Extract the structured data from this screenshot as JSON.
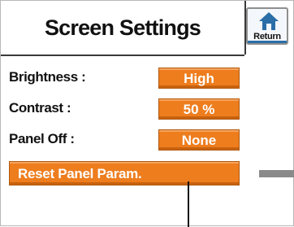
{
  "header": {
    "title": "Screen Settings",
    "return_label": "Return"
  },
  "settings": {
    "brightness": {
      "label": "Brightness :",
      "value": "High"
    },
    "contrast": {
      "label": "Contrast :",
      "value": "50 %"
    },
    "panel_off": {
      "label": "Panel Off :",
      "value": "None"
    }
  },
  "actions": {
    "reset_label": "Reset Panel Param."
  },
  "colors": {
    "accent": "#ee7d1e",
    "return_icon": "#2b6ea8"
  },
  "icons": {
    "return": "home-icon"
  }
}
